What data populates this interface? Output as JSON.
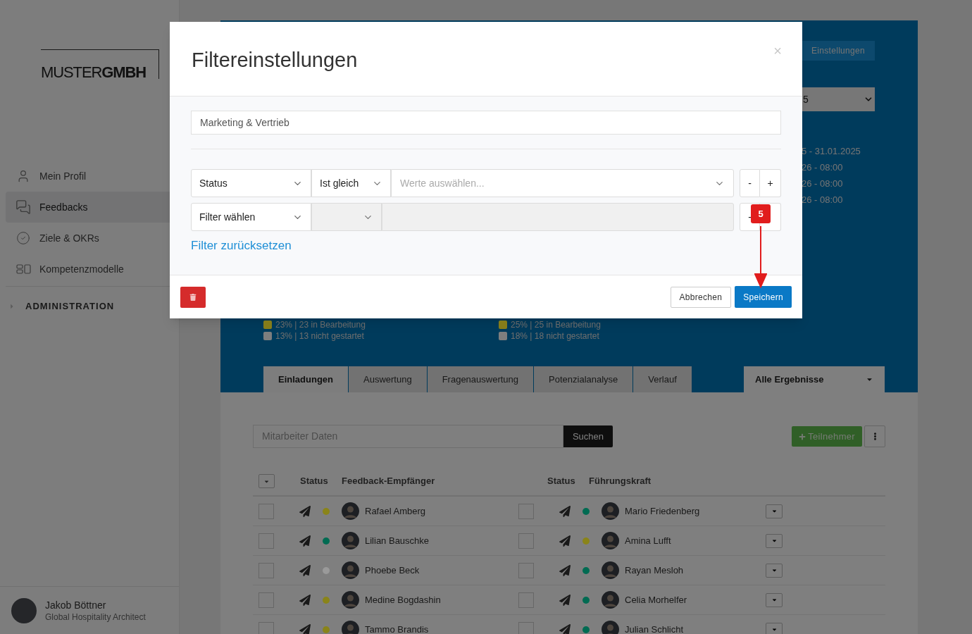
{
  "sidebar": {
    "logo": "MUSTER**GMBH**",
    "nav": [
      {
        "label": "Mein Profil",
        "kind": "user",
        "selected": false
      },
      {
        "label": "Feedbacks",
        "kind": "chat",
        "selected": true
      },
      {
        "label": "Ziele & OKRs",
        "kind": "check",
        "selected": false
      },
      {
        "label": "Kompetenzmodelle",
        "kind": "grid",
        "selected": false
      }
    ],
    "section": {
      "label": "ADMINISTRATION",
      "expanded": false
    },
    "user": {
      "name": "Jakob Böttner",
      "role": "Global Hospitality Architect"
    }
  },
  "header": {
    "settings_button": "Einstellungen",
    "period_select": "5",
    "dates": [
      "5 - 31.01.2025",
      "26 - 08:00",
      "26 - 08:00",
      "26 - 08:00"
    ],
    "legend": [
      [
        {
          "text": "23% | 23 in Bearbeitung",
          "color": "#857c1a"
        },
        {
          "text": "13% | 13 nicht gestartet",
          "color": "#7e7e7e"
        }
      ],
      [
        {
          "text": "25% | 25 in Bearbeitung",
          "color": "#857c1a"
        },
        {
          "text": "18% | 18 nicht gestartet",
          "color": "#7e7e7e"
        }
      ]
    ]
  },
  "tabs": [
    {
      "label": "Einladungen",
      "selected": true
    },
    {
      "label": "Auswertung",
      "selected": false
    },
    {
      "label": "Fragenauswertung",
      "selected": false
    },
    {
      "label": "Potenzialanalyse",
      "selected": false
    },
    {
      "label": "Verlauf",
      "selected": false
    }
  ],
  "results_dropdown": "Alle Ergebnisse",
  "search": {
    "placeholder": "Mitarbeiter Daten",
    "button": "Suchen"
  },
  "add_button": "Teilnehmer",
  "table": {
    "columns": [
      "Status",
      "Feedback-Empfänger",
      "Status",
      "Führungskraft"
    ],
    "rows": [
      {
        "recipient": {
          "name": "Rafael Amberg",
          "color": "#8a8419",
          "checked": false
        },
        "manager": {
          "name": "Mario Friedenberg",
          "color": "#006b52",
          "checked": false
        }
      },
      {
        "recipient": {
          "name": "Lilian Bauschke",
          "color": "#006b52",
          "checked": false
        },
        "manager": {
          "name": "Amina Lufft",
          "color": "#8a8419",
          "checked": false
        }
      },
      {
        "recipient": {
          "name": "Phoebe Beck",
          "color": "#9a9a9a",
          "checked": false
        },
        "manager": {
          "name": "Rayan Mesloh",
          "color": "#006b52",
          "checked": false
        }
      },
      {
        "recipient": {
          "name": "Medine Bogdashin",
          "color": "#8a8419",
          "checked": false
        },
        "manager": {
          "name": "Celia Morhelfer",
          "color": "#006b52",
          "checked": false
        }
      },
      {
        "recipient": {
          "name": "Tammo Brandis",
          "color": "#8a8419",
          "checked": false
        },
        "manager": {
          "name": "Julian Schlicht",
          "color": "#006b52",
          "checked": false
        }
      }
    ]
  },
  "modal": {
    "title": "Filtereinstellungen",
    "close": "×",
    "name_value": "Marketing & Vertrieb",
    "filters": [
      {
        "field": "Status",
        "operator": "Ist gleich",
        "value_placeholder": "Werte auswählen...",
        "disabled": false,
        "remove": "-",
        "add": "+"
      },
      {
        "field": "Filter wählen",
        "disabled": true,
        "remove": "-"
      }
    ],
    "reset_link": "Filter zurücksetzen",
    "cancel": "Abbrechen",
    "save": "Speichern"
  },
  "annotation": {
    "step": "5"
  }
}
